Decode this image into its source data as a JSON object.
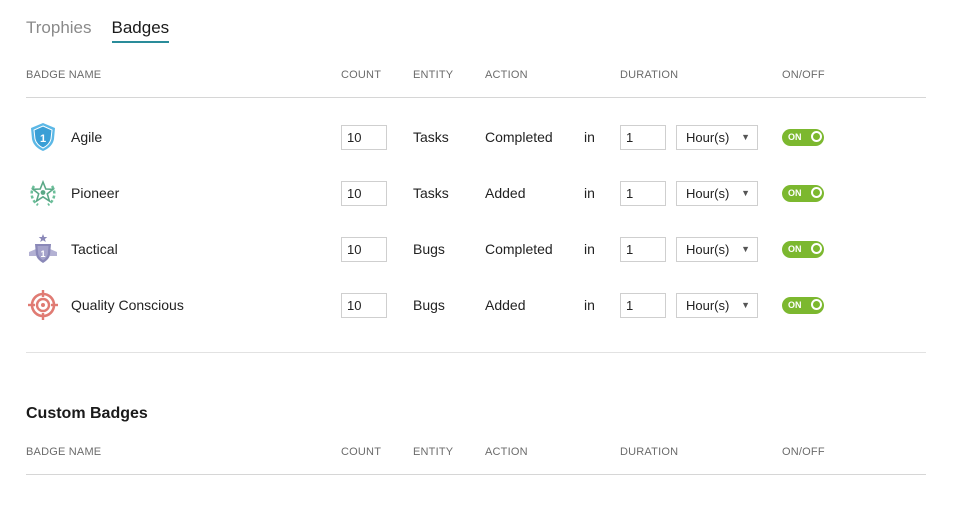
{
  "tabs": [
    {
      "label": "Trophies",
      "active": false
    },
    {
      "label": "Badges",
      "active": true
    }
  ],
  "columns": {
    "badge_name": "BADGE NAME",
    "count": "COUNT",
    "entity": "ENTITY",
    "action": "ACTION",
    "duration": "DURATION",
    "onoff": "ON/OFF"
  },
  "badges": [
    {
      "icon": "shield-one-icon",
      "name": "Agile",
      "count": "10",
      "entity": "Tasks",
      "action": "Completed",
      "in": "in",
      "duration": "1",
      "unit": "Hour(s)",
      "toggle": "ON"
    },
    {
      "icon": "star-wreath-icon",
      "name": "Pioneer",
      "count": "10",
      "entity": "Tasks",
      "action": "Added",
      "in": "in",
      "duration": "1",
      "unit": "Hour(s)",
      "toggle": "ON"
    },
    {
      "icon": "shield-ribbon-icon",
      "name": "Tactical",
      "count": "10",
      "entity": "Bugs",
      "action": "Completed",
      "in": "in",
      "duration": "1",
      "unit": "Hour(s)",
      "toggle": "ON"
    },
    {
      "icon": "target-icon",
      "name": "Quality Conscious",
      "count": "10",
      "entity": "Bugs",
      "action": "Added",
      "in": "in",
      "duration": "1",
      "unit": "Hour(s)",
      "toggle": "ON"
    }
  ],
  "custom": {
    "title": "Custom Badges"
  },
  "colors": {
    "accent": "#2a8c9a",
    "toggle_on": "#7cb82f"
  }
}
